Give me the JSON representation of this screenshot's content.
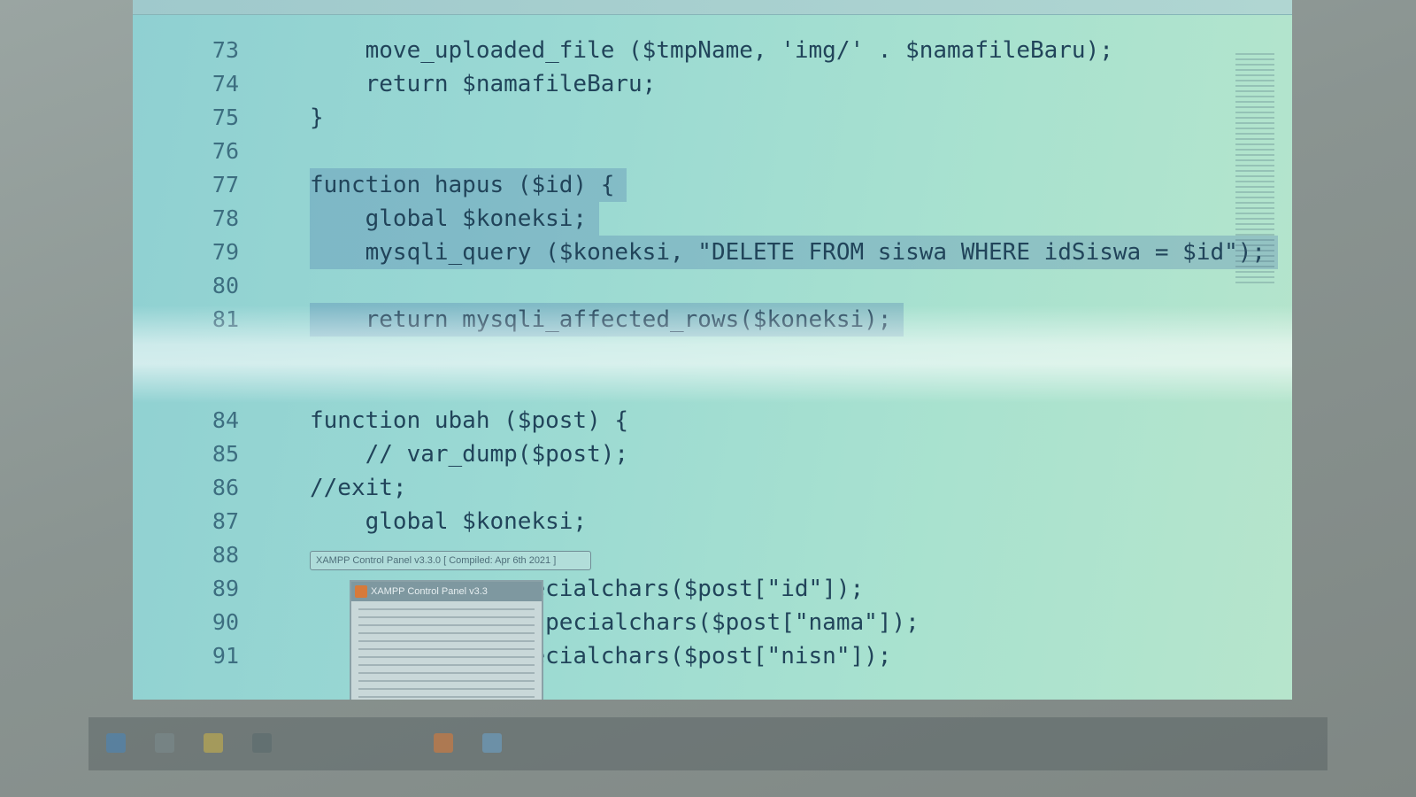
{
  "colors": {
    "editor_background": "#9ad9d3",
    "code_text": "#21445a",
    "line_number": "#3d6e80",
    "selection": "#466eaa"
  },
  "editor": {
    "lines": [
      {
        "num": "73",
        "code": "    move_uploaded_file ($tmpName, 'img/' . $namafileBaru);",
        "selected": false
      },
      {
        "num": "74",
        "code": "    return $namafileBaru;",
        "selected": false
      },
      {
        "num": "75",
        "code": "}",
        "selected": false
      },
      {
        "num": "76",
        "code": "",
        "selected": false
      },
      {
        "num": "77",
        "code": "function hapus ($id) {",
        "selected": true
      },
      {
        "num": "78",
        "code": "    global $koneksi;",
        "selected": true
      },
      {
        "num": "79",
        "code": "    mysqli_query ($koneksi, \"DELETE FROM siswa WHERE idSiswa = $id\");",
        "selected": true
      },
      {
        "num": "80",
        "code": "",
        "selected": true
      },
      {
        "num": "81",
        "code": "    return mysqli_affected_rows($koneksi);",
        "selected": true
      },
      {
        "num": "",
        "code": "",
        "selected": false
      },
      {
        "num": "",
        "code": "",
        "selected": false
      },
      {
        "num": "84",
        "code": "function ubah ($post) {",
        "selected": false
      },
      {
        "num": "85",
        "code": "    // var_dump($post);",
        "selected": false
      },
      {
        "num": "86",
        "code": "//exit;",
        "selected": false
      },
      {
        "num": "87",
        "code": "    global $koneksi;",
        "selected": false
      },
      {
        "num": "88",
        "code": "",
        "selected": false
      },
      {
        "num": "89",
        "code": "                ecialchars($post[\"id\"]);",
        "selected": false
      },
      {
        "num": "90",
        "code": "                specialchars($post[\"nama\"]);",
        "selected": false
      },
      {
        "num": "91",
        "code": "                ecialchars($post[\"nisn\"]);",
        "selected": false
      }
    ]
  },
  "taskbar_preview": {
    "chip_text": "XAMPP Control Panel v3.3.0   [ Compiled: Apr 6th 2021 ]",
    "window_title": "XAMPP Control Panel v3.3"
  },
  "icons": [
    "windows-start-icon",
    "search-icon",
    "file-explorer-icon",
    "terminal-icon",
    "xampp-icon",
    "browser-icon"
  ]
}
